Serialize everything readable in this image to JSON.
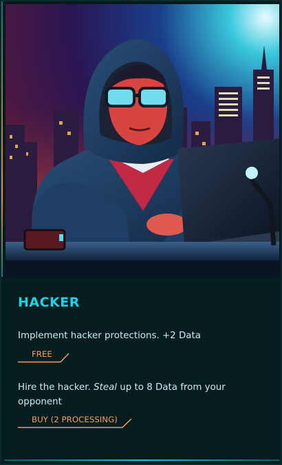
{
  "card": {
    "title": "HACKER",
    "image_alt": "hooded hacker with goggles typing on a laptop in front of a neon city skyline",
    "options": [
      {
        "text": "Implement hacker protections. +2 Data",
        "button_label": "FREE"
      },
      {
        "text_before": "Hire the hacker. ",
        "text_emphasis": "Steal",
        "text_after": " up to 8 Data from your opponent",
        "button_label": "BUY (2 PROCESSING)"
      }
    ]
  },
  "colors": {
    "title": "#19d5e6",
    "text": "#c6eef2",
    "button": "#ff9c5b",
    "background": "#061d20"
  }
}
